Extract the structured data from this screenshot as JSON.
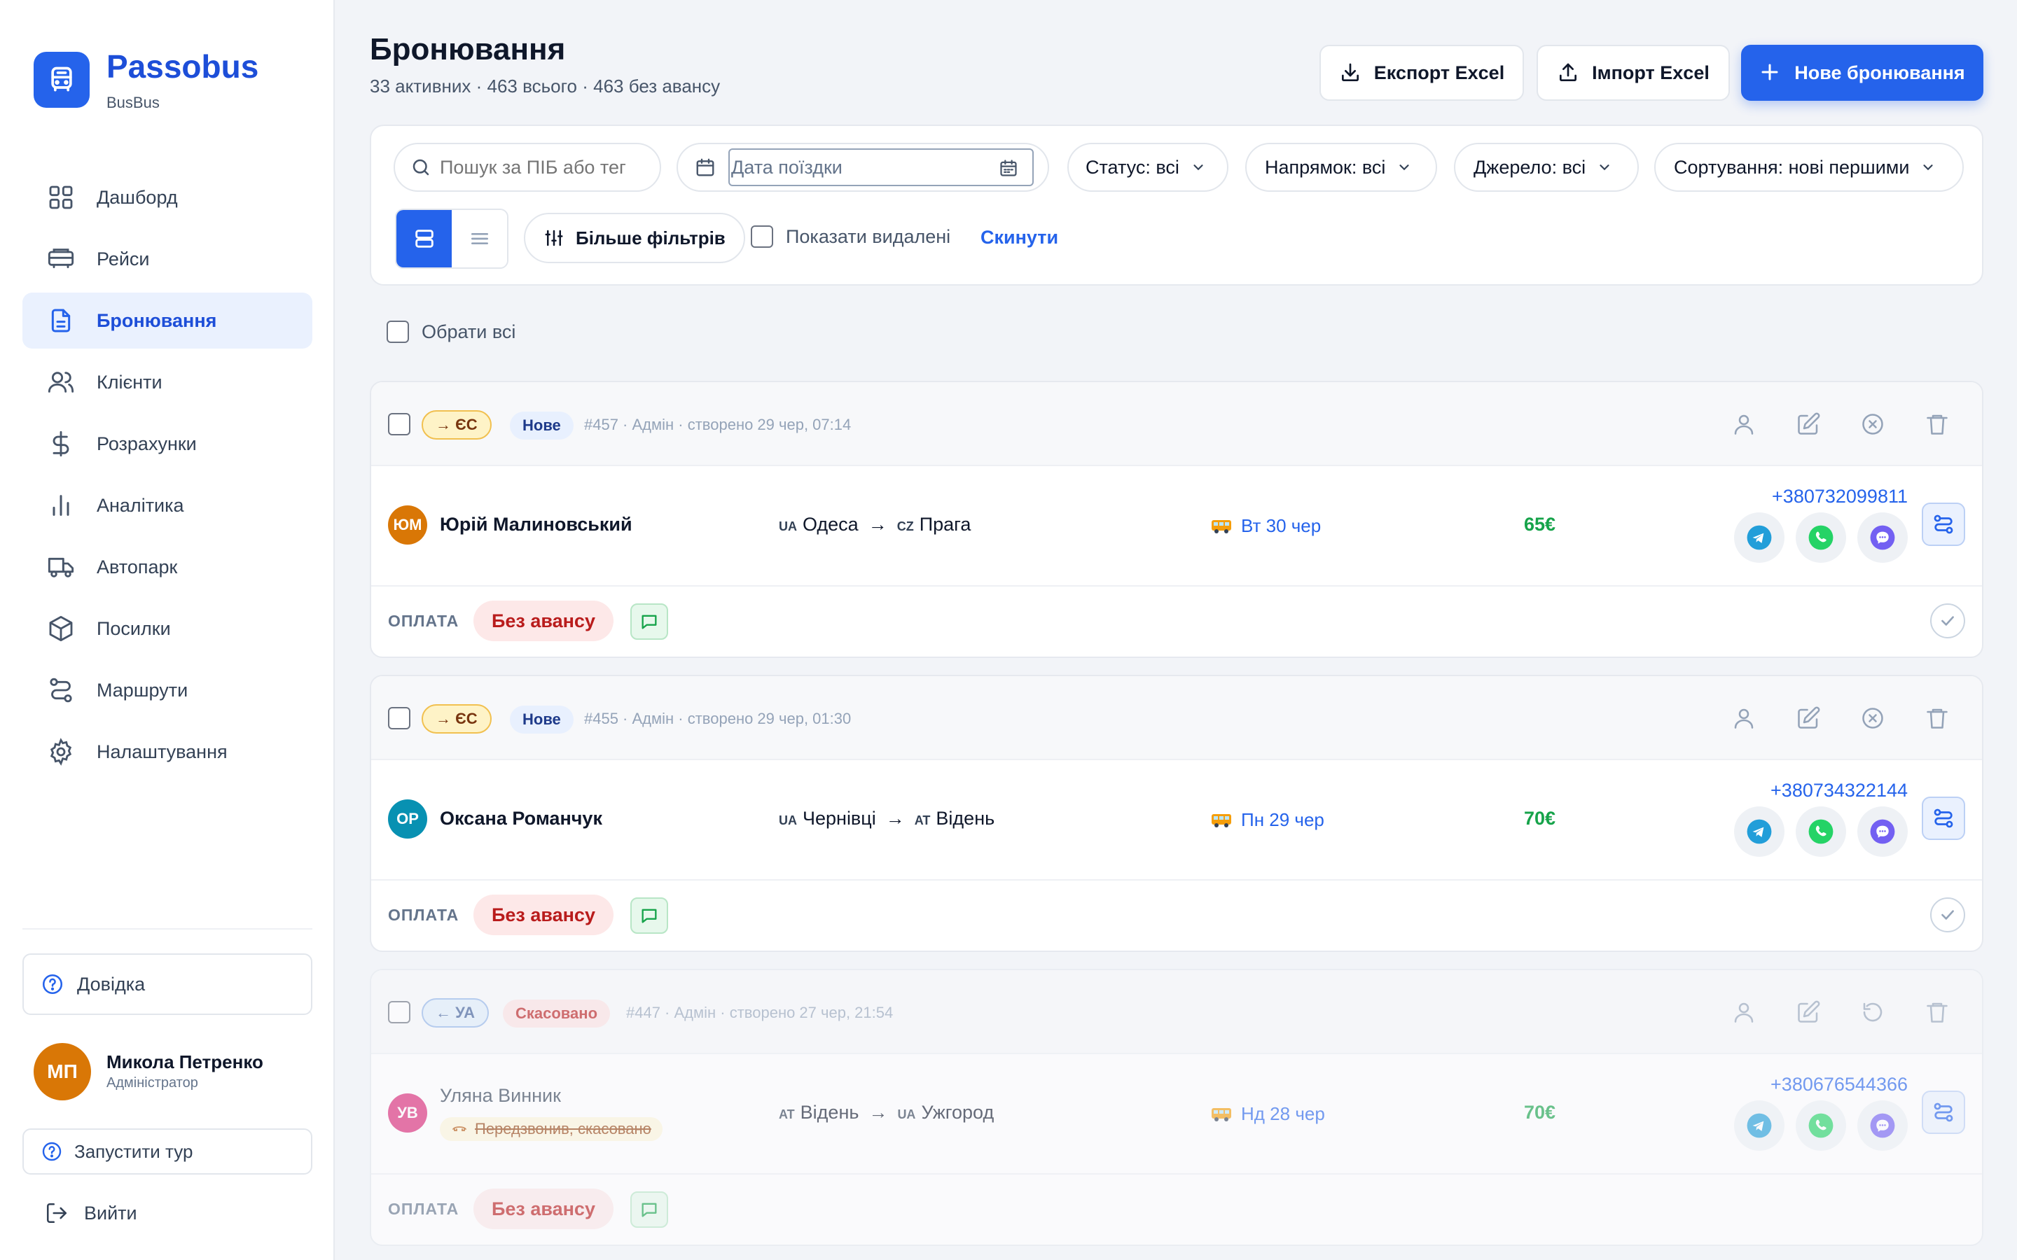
{
  "app": {
    "brand": "Passobus",
    "brand_sub": "BusBus"
  },
  "sidebar": {
    "items": [
      {
        "label": "Дашборд",
        "icon": "grid-icon"
      },
      {
        "label": "Рейси",
        "icon": "bus-icon"
      },
      {
        "label": "Бронювання",
        "icon": "document-icon",
        "active": true
      },
      {
        "label": "Клієнти",
        "icon": "users-icon"
      },
      {
        "label": "Розрахунки",
        "icon": "dollar-icon"
      },
      {
        "label": "Аналітика",
        "icon": "bar-chart-icon"
      },
      {
        "label": "Автопарк",
        "icon": "truck-icon"
      },
      {
        "label": "Посилки",
        "icon": "package-icon"
      },
      {
        "label": "Маршрути",
        "icon": "route-icon"
      },
      {
        "label": "Налаштування",
        "icon": "gear-icon"
      }
    ],
    "help": "Довідка",
    "user": {
      "initials": "МП",
      "name": "Микола Петренко",
      "role": "Адміністратор"
    },
    "tour": "Запустити тур",
    "logout": "Вийти"
  },
  "header": {
    "title": "Бронювання",
    "subtitle": "33 активних · 463 всього · 463 без авансу",
    "export_label": "Експорт Excel",
    "import_label": "Імпорт Excel",
    "new_label": "Нове бронювання"
  },
  "filters": {
    "search_placeholder": "Пошук за ПІБ або тег",
    "date_placeholder": "Дата поїздки",
    "status": "Статус: всі",
    "direction": "Напрямок: всі",
    "source": "Джерело: всі",
    "sort": "Сортування: нові першими",
    "more_filters": "Більше фільтрів",
    "show_deleted": "Показати видалені",
    "reset": "Скинути"
  },
  "select_all": "Обрати всі",
  "bookings": [
    {
      "direction": "→ ЄС",
      "status": "Нове",
      "meta": "#457 · Адмін · створено 29 чер, 07:14",
      "initials": "ЮМ",
      "avatar_color": "#d97706",
      "client": "Юрій Малиновський",
      "from_cc": "UA",
      "from": "Одеса",
      "to_cc": "CZ",
      "to": "Прага",
      "date": "Вт 30 чер",
      "price": "65€",
      "phone": "+380732099811",
      "pay_label": "ОПЛАТА",
      "pay_status": "Без авансу"
    },
    {
      "direction": "→ ЄС",
      "status": "Нове",
      "meta": "#455 · Адмін · створено 29 чер, 01:30",
      "initials": "ОР",
      "avatar_color": "#0891b2",
      "client": "Оксана Романчук",
      "from_cc": "UA",
      "from": "Чернівці",
      "to_cc": "AT",
      "to": "Відень",
      "date": "Пн 29 чер",
      "price": "70€",
      "phone": "+380734322144",
      "pay_label": "ОПЛАТА",
      "pay_status": "Без авансу"
    },
    {
      "direction": "← УА",
      "status": "Скасовано",
      "meta": "#447 · Адмін · створено 27 чер, 21:54",
      "initials": "УВ",
      "avatar_color": "#db2777",
      "client": "Уляна Винник",
      "note": "Передзвонив, скасовано",
      "from_cc": "AT",
      "from": "Відень",
      "to_cc": "UA",
      "to": "Ужгород",
      "date": "Нд 28 чер",
      "price": "70€",
      "phone": "+380676544366",
      "pay_label": "ОПЛАТА",
      "pay_status": "Без авансу"
    }
  ],
  "colors": {
    "accent": "#2563eb",
    "price": "#16a34a",
    "danger": "#b91c1c"
  }
}
